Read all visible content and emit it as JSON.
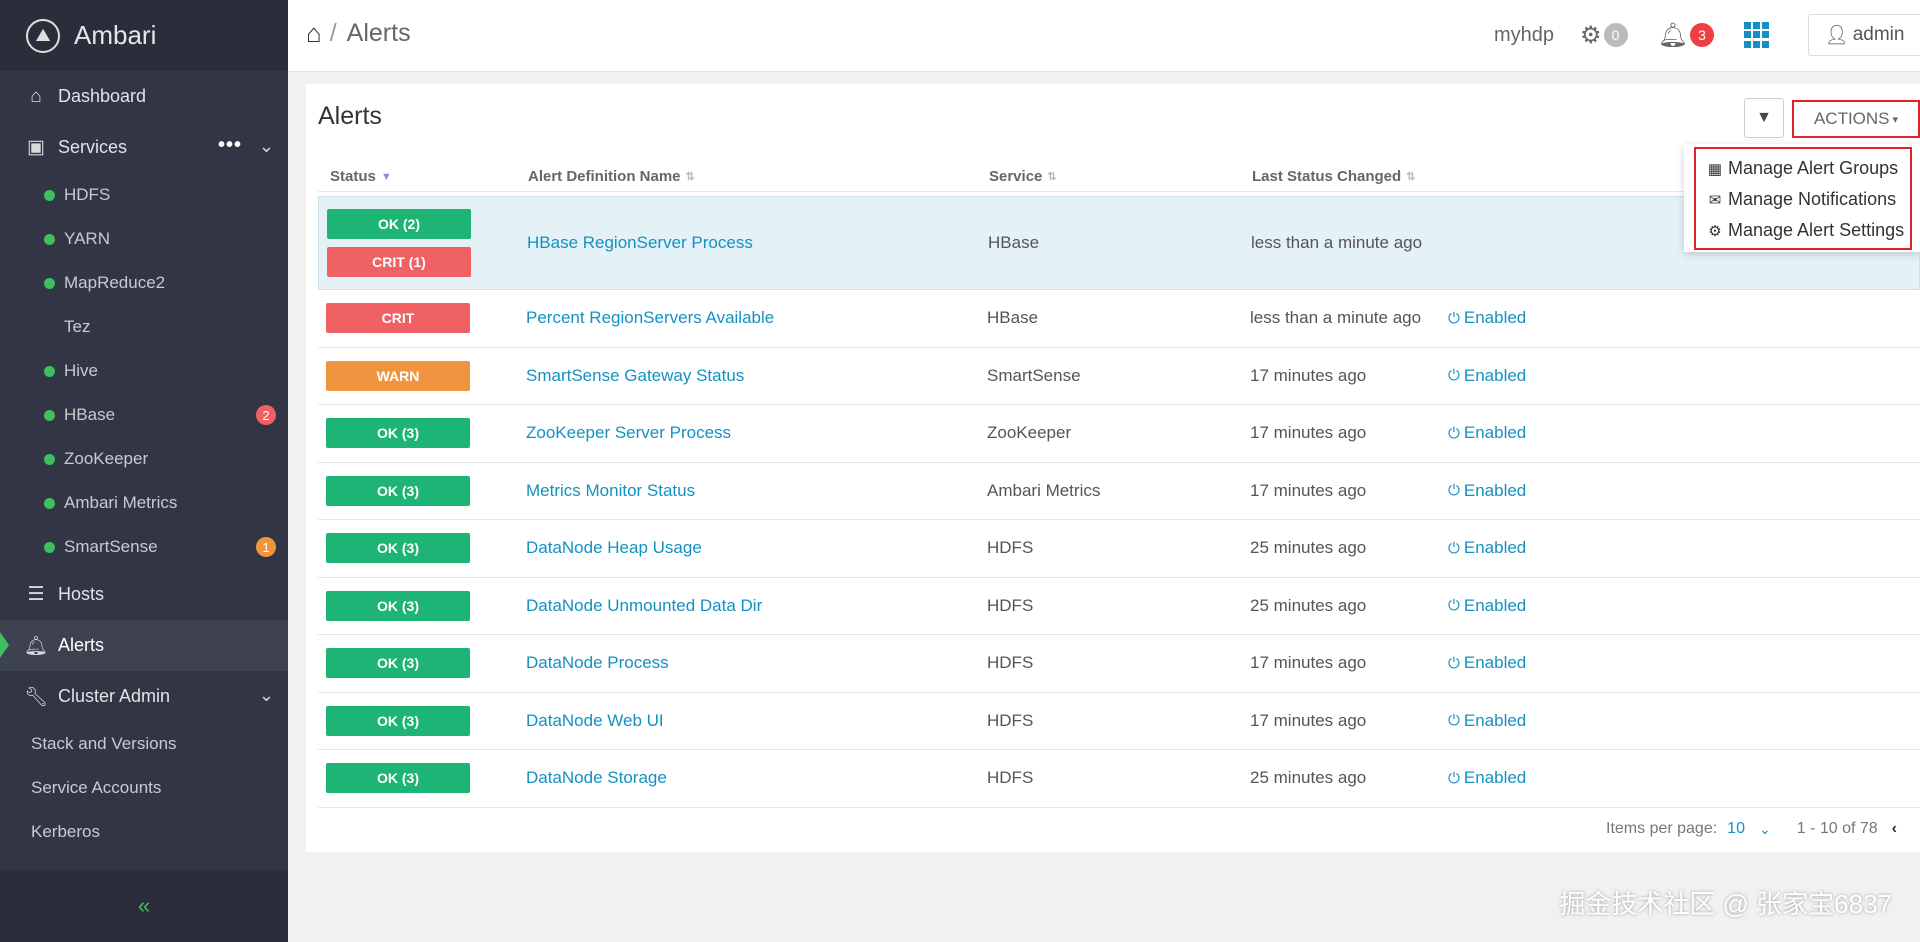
{
  "app": {
    "name": "Ambari"
  },
  "sidebar": {
    "dashboard": "Dashboard",
    "services_label": "Services",
    "services": [
      {
        "label": "HDFS",
        "dot": true,
        "badge": ""
      },
      {
        "label": "YARN",
        "dot": true,
        "badge": ""
      },
      {
        "label": "MapReduce2",
        "dot": true,
        "badge": ""
      },
      {
        "label": "Tez",
        "dot": false,
        "badge": ""
      },
      {
        "label": "Hive",
        "dot": true,
        "badge": ""
      },
      {
        "label": "HBase",
        "dot": true,
        "badge": "2",
        "badge_color": "#ef6162"
      },
      {
        "label": "ZooKeeper",
        "dot": true,
        "badge": ""
      },
      {
        "label": "Ambari Metrics",
        "dot": true,
        "badge": ""
      },
      {
        "label": "SmartSense",
        "dot": true,
        "badge": "1",
        "badge_color": "#f09440"
      }
    ],
    "hosts": "Hosts",
    "alerts": "Alerts",
    "cluster_admin": "Cluster Admin",
    "admin_items": [
      "Stack and Versions",
      "Service Accounts",
      "Kerberos"
    ]
  },
  "topbar": {
    "breadcrumb": "Alerts",
    "cluster_name": "myhdp",
    "ops_count": "0",
    "alerts_count": "3",
    "user": "admin"
  },
  "main": {
    "title": "Alerts",
    "actions_label": "ACTIONS",
    "actions_menu": [
      "Manage Alert Groups",
      "Manage Notifications",
      "Manage Alert Settings"
    ],
    "columns": {
      "status": "Status",
      "name": "Alert Definition Name",
      "service": "Service",
      "last_changed": "Last Status Changed"
    },
    "rows": [
      {
        "status": [
          {
            "label": "OK (2)",
            "kind": "ok"
          },
          {
            "label": "CRIT (1)",
            "kind": "crit"
          }
        ],
        "name": "HBase RegionServer Process",
        "service": "HBase",
        "last_changed": "less than a minute ago",
        "state": ""
      },
      {
        "status": [
          {
            "label": "CRIT",
            "kind": "crit"
          }
        ],
        "name": "Percent RegionServers Available",
        "service": "HBase",
        "last_changed": "less than a minute ago",
        "state": "Enabled"
      },
      {
        "status": [
          {
            "label": "WARN",
            "kind": "warn"
          }
        ],
        "name": "SmartSense Gateway Status",
        "service": "SmartSense",
        "last_changed": "17 minutes ago",
        "state": "Enabled"
      },
      {
        "status": [
          {
            "label": "OK (3)",
            "kind": "ok"
          }
        ],
        "name": "ZooKeeper Server Process",
        "service": "ZooKeeper",
        "last_changed": "17 minutes ago",
        "state": "Enabled"
      },
      {
        "status": [
          {
            "label": "OK (3)",
            "kind": "ok"
          }
        ],
        "name": "Metrics Monitor Status",
        "service": "Ambari Metrics",
        "last_changed": "17 minutes ago",
        "state": "Enabled"
      },
      {
        "status": [
          {
            "label": "OK (3)",
            "kind": "ok"
          }
        ],
        "name": "DataNode Heap Usage",
        "service": "HDFS",
        "last_changed": "25 minutes ago",
        "state": "Enabled"
      },
      {
        "status": [
          {
            "label": "OK (3)",
            "kind": "ok"
          }
        ],
        "name": "DataNode Unmounted Data Dir",
        "service": "HDFS",
        "last_changed": "25 minutes ago",
        "state": "Enabled"
      },
      {
        "status": [
          {
            "label": "OK (3)",
            "kind": "ok"
          }
        ],
        "name": "DataNode Process",
        "service": "HDFS",
        "last_changed": "17 minutes ago",
        "state": "Enabled"
      },
      {
        "status": [
          {
            "label": "OK (3)",
            "kind": "ok"
          }
        ],
        "name": "DataNode Web UI",
        "service": "HDFS",
        "last_changed": "17 minutes ago",
        "state": "Enabled"
      },
      {
        "status": [
          {
            "label": "OK (3)",
            "kind": "ok"
          }
        ],
        "name": "DataNode Storage",
        "service": "HDFS",
        "last_changed": "25 minutes ago",
        "state": "Enabled"
      }
    ],
    "pagination": {
      "items_per_page_label": "Items per page:",
      "items_per_page": "10",
      "range": "1 - 10 of 78"
    }
  },
  "watermark": "掘金技术社区 @ 张家宝6837"
}
